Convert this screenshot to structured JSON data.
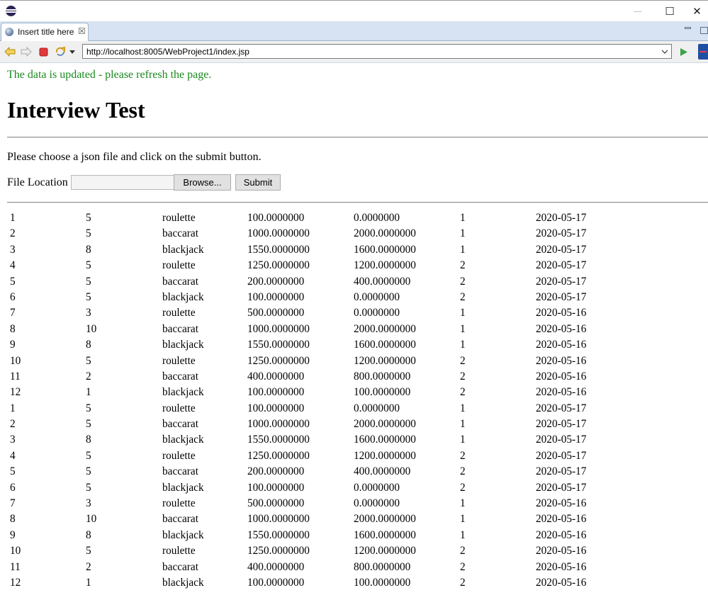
{
  "window": {
    "minimize_glyph": "—",
    "maximize_glyph": "☐",
    "close_glyph": "✕"
  },
  "tab": {
    "title": "Insert title here",
    "close_glyph": "☒"
  },
  "address_bar": {
    "url": "http://localhost:8005/WebProject1/index.jsp"
  },
  "page": {
    "notice": "The data is updated - please refresh the page.",
    "notice_color": "#188a1e",
    "heading": "Interview Test",
    "instruction": "Please choose a json file and click on the submit button.",
    "file_label": "File Location",
    "file_value": "",
    "browse_label": "Browse...",
    "submit_label": "Submit"
  },
  "rows": [
    [
      "1",
      "5",
      "roulette",
      "100.0000000",
      "0.0000000",
      "1",
      "2020-05-17"
    ],
    [
      "2",
      "5",
      "baccarat",
      "1000.0000000",
      "2000.0000000",
      "1",
      "2020-05-17"
    ],
    [
      "3",
      "8",
      "blackjack",
      "1550.0000000",
      "1600.0000000",
      "1",
      "2020-05-17"
    ],
    [
      "4",
      "5",
      "roulette",
      "1250.0000000",
      "1200.0000000",
      "2",
      "2020-05-17"
    ],
    [
      "5",
      "5",
      "baccarat",
      "200.0000000",
      "400.0000000",
      "2",
      "2020-05-17"
    ],
    [
      "6",
      "5",
      "blackjack",
      "100.0000000",
      "0.0000000",
      "2",
      "2020-05-17"
    ],
    [
      "7",
      "3",
      "roulette",
      "500.0000000",
      "0.0000000",
      "1",
      "2020-05-16"
    ],
    [
      "8",
      "10",
      "baccarat",
      "1000.0000000",
      "2000.0000000",
      "1",
      "2020-05-16"
    ],
    [
      "9",
      "8",
      "blackjack",
      "1550.0000000",
      "1600.0000000",
      "1",
      "2020-05-16"
    ],
    [
      "10",
      "5",
      "roulette",
      "1250.0000000",
      "1200.0000000",
      "2",
      "2020-05-16"
    ],
    [
      "11",
      "2",
      "baccarat",
      "400.0000000",
      "800.0000000",
      "2",
      "2020-05-16"
    ],
    [
      "12",
      "1",
      "blackjack",
      "100.0000000",
      "100.0000000",
      "2",
      "2020-05-16"
    ],
    [
      "1",
      "5",
      "roulette",
      "100.0000000",
      "0.0000000",
      "1",
      "2020-05-17"
    ],
    [
      "2",
      "5",
      "baccarat",
      "1000.0000000",
      "2000.0000000",
      "1",
      "2020-05-17"
    ],
    [
      "3",
      "8",
      "blackjack",
      "1550.0000000",
      "1600.0000000",
      "1",
      "2020-05-17"
    ],
    [
      "4",
      "5",
      "roulette",
      "1250.0000000",
      "1200.0000000",
      "2",
      "2020-05-17"
    ],
    [
      "5",
      "5",
      "baccarat",
      "200.0000000",
      "400.0000000",
      "2",
      "2020-05-17"
    ],
    [
      "6",
      "5",
      "blackjack",
      "100.0000000",
      "0.0000000",
      "2",
      "2020-05-17"
    ],
    [
      "7",
      "3",
      "roulette",
      "500.0000000",
      "0.0000000",
      "1",
      "2020-05-16"
    ],
    [
      "8",
      "10",
      "baccarat",
      "1000.0000000",
      "2000.0000000",
      "1",
      "2020-05-16"
    ],
    [
      "9",
      "8",
      "blackjack",
      "1550.0000000",
      "1600.0000000",
      "1",
      "2020-05-16"
    ],
    [
      "10",
      "5",
      "roulette",
      "1250.0000000",
      "1200.0000000",
      "2",
      "2020-05-16"
    ],
    [
      "11",
      "2",
      "baccarat",
      "400.0000000",
      "800.0000000",
      "2",
      "2020-05-16"
    ],
    [
      "12",
      "1",
      "blackjack",
      "100.0000000",
      "100.0000000",
      "2",
      "2020-05-16"
    ]
  ]
}
